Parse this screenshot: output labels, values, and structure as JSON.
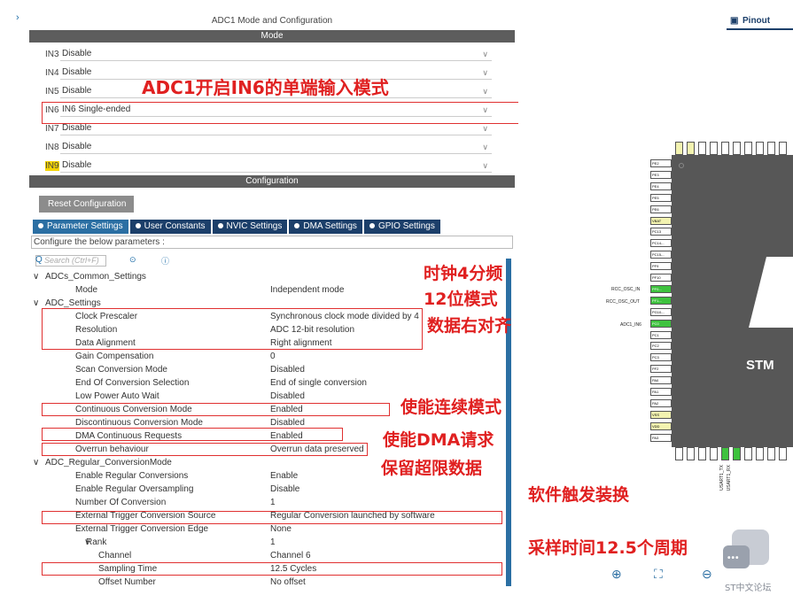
{
  "window_title": "ADC1 Mode and Configuration",
  "mode_header": "Mode",
  "config_header": "Configuration",
  "mode_rows": [
    {
      "label": "IN3",
      "value": "Disable"
    },
    {
      "label": "IN4",
      "value": "Disable"
    },
    {
      "label": "IN5",
      "value": "Disable"
    },
    {
      "label": "IN6",
      "value": "IN6 Single-ended"
    },
    {
      "label": "IN7",
      "value": "Disable"
    },
    {
      "label": "IN8",
      "value": "Disable"
    },
    {
      "label": "IN9",
      "value": "Disable"
    }
  ],
  "reset_button": "Reset Configuration",
  "tabs": [
    "Parameter Settings",
    "User Constants",
    "NVIC Settings",
    "DMA Settings",
    "GPIO Settings"
  ],
  "configure_text": "Configure the below parameters :",
  "search_placeholder": "Search (Ctrl+F)",
  "params": [
    {
      "name": "ADCs_Common_Settings",
      "value": "",
      "level": 0,
      "group": true
    },
    {
      "name": "Mode",
      "value": "Independent mode",
      "level": 2
    },
    {
      "name": "ADC_Settings",
      "value": "",
      "level": 0,
      "group": true
    },
    {
      "name": "Clock Prescaler",
      "value": "Synchronous clock mode divided by 4",
      "level": 2
    },
    {
      "name": "Resolution",
      "value": "ADC 12-bit resolution",
      "level": 2
    },
    {
      "name": "Data Alignment",
      "value": "Right alignment",
      "level": 2
    },
    {
      "name": "Gain Compensation",
      "value": "0",
      "level": 2
    },
    {
      "name": "Scan Conversion Mode",
      "value": "Disabled",
      "level": 2
    },
    {
      "name": "End Of Conversion Selection",
      "value": "End of single conversion",
      "level": 2
    },
    {
      "name": "Low Power Auto Wait",
      "value": "Disabled",
      "level": 2
    },
    {
      "name": "Continuous Conversion Mode",
      "value": "Enabled",
      "level": 2
    },
    {
      "name": "Discontinuous Conversion Mode",
      "value": "Disabled",
      "level": 2
    },
    {
      "name": "DMA Continuous Requests",
      "value": "Enabled",
      "level": 2
    },
    {
      "name": "Overrun behaviour",
      "value": "Overrun data preserved",
      "level": 2
    },
    {
      "name": "ADC_Regular_ConversionMode",
      "value": "",
      "level": 0,
      "group": true
    },
    {
      "name": "Enable Regular Conversions",
      "value": "Enable",
      "level": 2
    },
    {
      "name": "Enable Regular Oversampling",
      "value": "Disable",
      "level": 2
    },
    {
      "name": "Number Of Conversion",
      "value": "1",
      "level": 2
    },
    {
      "name": "External Trigger Conversion Source",
      "value": "Regular Conversion launched by software",
      "level": 2
    },
    {
      "name": "External Trigger Conversion Edge",
      "value": "None",
      "level": 2
    },
    {
      "name": "Rank",
      "value": "1",
      "level": 3,
      "group": true
    },
    {
      "name": "Channel",
      "value": "Channel 6",
      "level": 4
    },
    {
      "name": "Sampling Time",
      "value": "12.5 Cycles",
      "level": 4
    },
    {
      "name": "Offset Number",
      "value": "No offset",
      "level": 4
    }
  ],
  "annotations": {
    "in6": "ADC1开启IN6的单端输入模式",
    "clock": "时钟4分频",
    "resolution": "12位模式",
    "align": "数据右对齐",
    "continuous": "使能连续模式",
    "dma": "使能DMA请求",
    "overrun": "保留超限数据",
    "trigger": "软件触发装换",
    "sampling": "采样时间12.5个周期"
  },
  "pinout_tab": "Pinout",
  "chip_text": "STM",
  "left_pins": [
    "PE2",
    "PE3",
    "PE4",
    "PE5",
    "PE6",
    "VBAT",
    "PC13",
    "PC14-..",
    "PC15-..",
    "PF9",
    "PF10",
    "PF0-..",
    "PF1-..",
    "PG10-..",
    "PC0",
    "PC1",
    "PC2",
    "PC3",
    "PF2",
    "PA0",
    "PA1",
    "PA2",
    "VSS",
    "VDD",
    "PA3"
  ],
  "top_pins": [
    "VDD",
    "VSS",
    "PE1",
    "PE0",
    "PB9",
    "PB8-B..",
    "PB7",
    "PB6",
    "PB5",
    "PB4"
  ],
  "bottom_pins": [
    "PA4",
    "PA5",
    "PA6",
    "PA7",
    "PC4",
    "PC5",
    "PB0",
    "PB1",
    "PB2",
    "VSSA"
  ],
  "ext_labels": {
    "osc_in": "RCC_OSC_IN",
    "osc_out": "RCC_OSC_OUT",
    "adc": "ADC1_IN6",
    "tx": "USART1_TX",
    "rx": "USART1_RX"
  },
  "watermark": "ST中文论坛",
  "colors": {
    "tab_active": "#2b6fa3",
    "tab": "#1c3f6a",
    "annotation": "#e02020",
    "highlight": "#f5d400",
    "pin_green": "#3ec23e"
  }
}
